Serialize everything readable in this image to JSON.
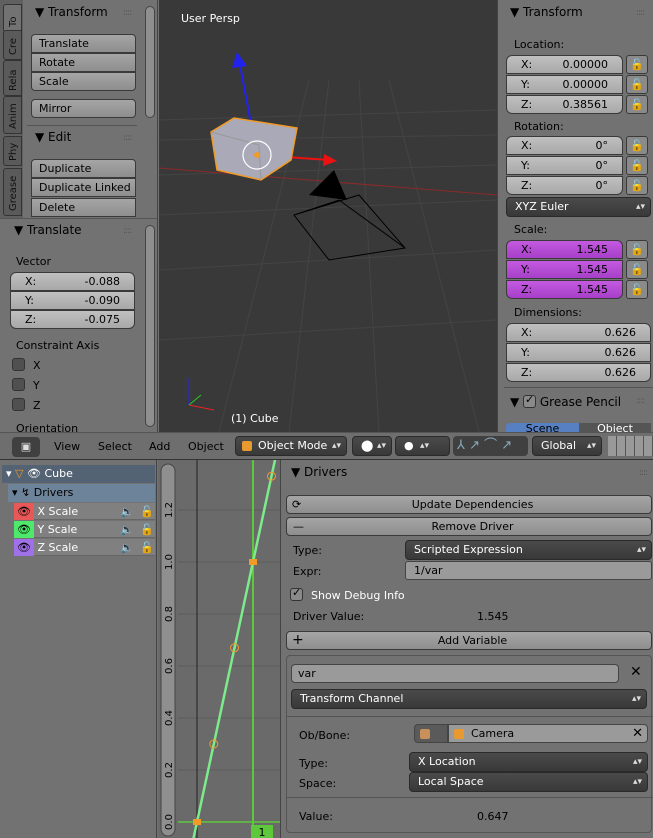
{
  "toolshelf": {
    "tabs": [
      "To",
      "Cre",
      "Rela",
      "Anim",
      "Phy",
      "Grease"
    ],
    "transform": {
      "title": "Transform",
      "buttons": [
        "Translate",
        "Rotate",
        "Scale"
      ],
      "mirror": "Mirror"
    },
    "edit": {
      "title": "Edit",
      "buttons": [
        "Duplicate",
        "Duplicate Linked",
        "Delete"
      ]
    }
  },
  "operator": {
    "title": "Translate",
    "vector_label": "Vector",
    "vector": [
      {
        "axis": "X:",
        "value": "-0.088"
      },
      {
        "axis": "Y:",
        "value": "-0.090"
      },
      {
        "axis": "Z:",
        "value": "-0.075"
      }
    ],
    "constraint_label": "Constraint Axis",
    "constraints": [
      "X",
      "Y",
      "Z"
    ],
    "orientation_label": "Orientation"
  },
  "viewport": {
    "view_name": "User Persp",
    "object_label": "(1) Cube"
  },
  "npanel": {
    "title": "Transform",
    "location_label": "Location:",
    "location": [
      {
        "axis": "X:",
        "value": "0.00000"
      },
      {
        "axis": "Y:",
        "value": "0.00000"
      },
      {
        "axis": "Z:",
        "value": "0.38561"
      }
    ],
    "rotation_label": "Rotation:",
    "rotation": [
      {
        "axis": "X:",
        "value": "0°"
      },
      {
        "axis": "Y:",
        "value": "0°"
      },
      {
        "axis": "Z:",
        "value": "0°"
      }
    ],
    "rotation_mode": "XYZ Euler",
    "scale_label": "Scale:",
    "scale": [
      {
        "axis": "X:",
        "value": "1.545"
      },
      {
        "axis": "Y:",
        "value": "1.545"
      },
      {
        "axis": "Z:",
        "value": "1.545"
      }
    ],
    "dimensions_label": "Dimensions:",
    "dimensions": [
      {
        "axis": "X:",
        "value": "0.626"
      },
      {
        "axis": "Y:",
        "value": "0.626"
      },
      {
        "axis": "Z:",
        "value": "0.626"
      }
    ],
    "grease_pencil": "Grease Pencil",
    "gp_tabs": [
      "Scene",
      "Object"
    ]
  },
  "header": {
    "menus": [
      "View",
      "Select",
      "Add",
      "Object"
    ],
    "mode": "Object Mode",
    "orientation": "Global"
  },
  "channels": {
    "object": "Cube",
    "drivers": "Drivers",
    "items": [
      {
        "name": "X Scale",
        "color": "#e85858"
      },
      {
        "name": "Y Scale",
        "color": "#4ee86a"
      },
      {
        "name": "Z Scale",
        "color": "#a070e8"
      }
    ]
  },
  "graph": {
    "y_ticks": [
      "0.0",
      "0.2",
      "0.4",
      "0.6",
      "0.8",
      "1.0",
      "1.2"
    ],
    "frame": "1",
    "curve": [
      [
        0,
        0
      ],
      [
        1,
        1
      ]
    ],
    "curve_color": "#7dea8c"
  },
  "drivers": {
    "title": "Drivers",
    "update": "Update Dependencies",
    "remove": "Remove Driver",
    "type_label": "Type:",
    "type": "Scripted Expression",
    "expr_label": "Expr:",
    "expr": "1/var",
    "debug": "Show Debug Info",
    "driver_value_label": "Driver Value:",
    "driver_value": "1.545",
    "add_variable": "Add Variable",
    "variable": {
      "name": "var",
      "var_type": "Transform Channel",
      "ob_label": "Ob/Bone:",
      "ob": "Camera",
      "type_label": "Type:",
      "type": "X Location",
      "space_label": "Space:",
      "space": "Local Space",
      "value_label": "Value:",
      "value": "0.647"
    }
  }
}
